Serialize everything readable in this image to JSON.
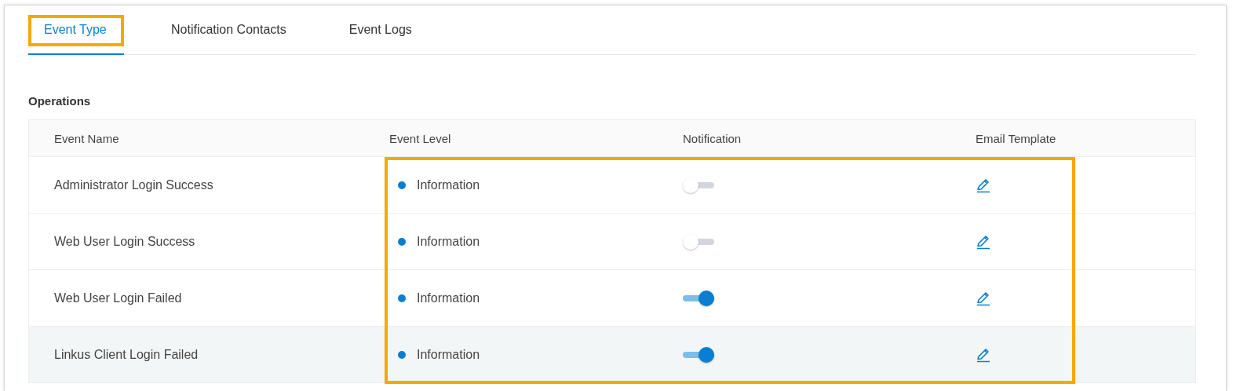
{
  "tabs": [
    {
      "label": "Event Type",
      "selected": true,
      "highlighted": true
    },
    {
      "label": "Notification Contacts",
      "selected": false,
      "highlighted": false
    },
    {
      "label": "Event Logs",
      "selected": false,
      "highlighted": false
    }
  ],
  "section": {
    "title": "Operations"
  },
  "table": {
    "columns": [
      "Event Name",
      "Event Level",
      "Notification",
      "Email Template"
    ],
    "highlight_frame": true,
    "rows": [
      {
        "event_name": "Administrator Login Success",
        "level": "Information",
        "notification": false,
        "hovered": false
      },
      {
        "event_name": "Web User Login Success",
        "level": "Information",
        "notification": false,
        "hovered": false
      },
      {
        "event_name": "Web User Login Failed",
        "level": "Information",
        "notification": true,
        "hovered": false
      },
      {
        "event_name": "Linkus Client Login Failed",
        "level": "Information",
        "notification": true,
        "hovered": true
      }
    ]
  }
}
